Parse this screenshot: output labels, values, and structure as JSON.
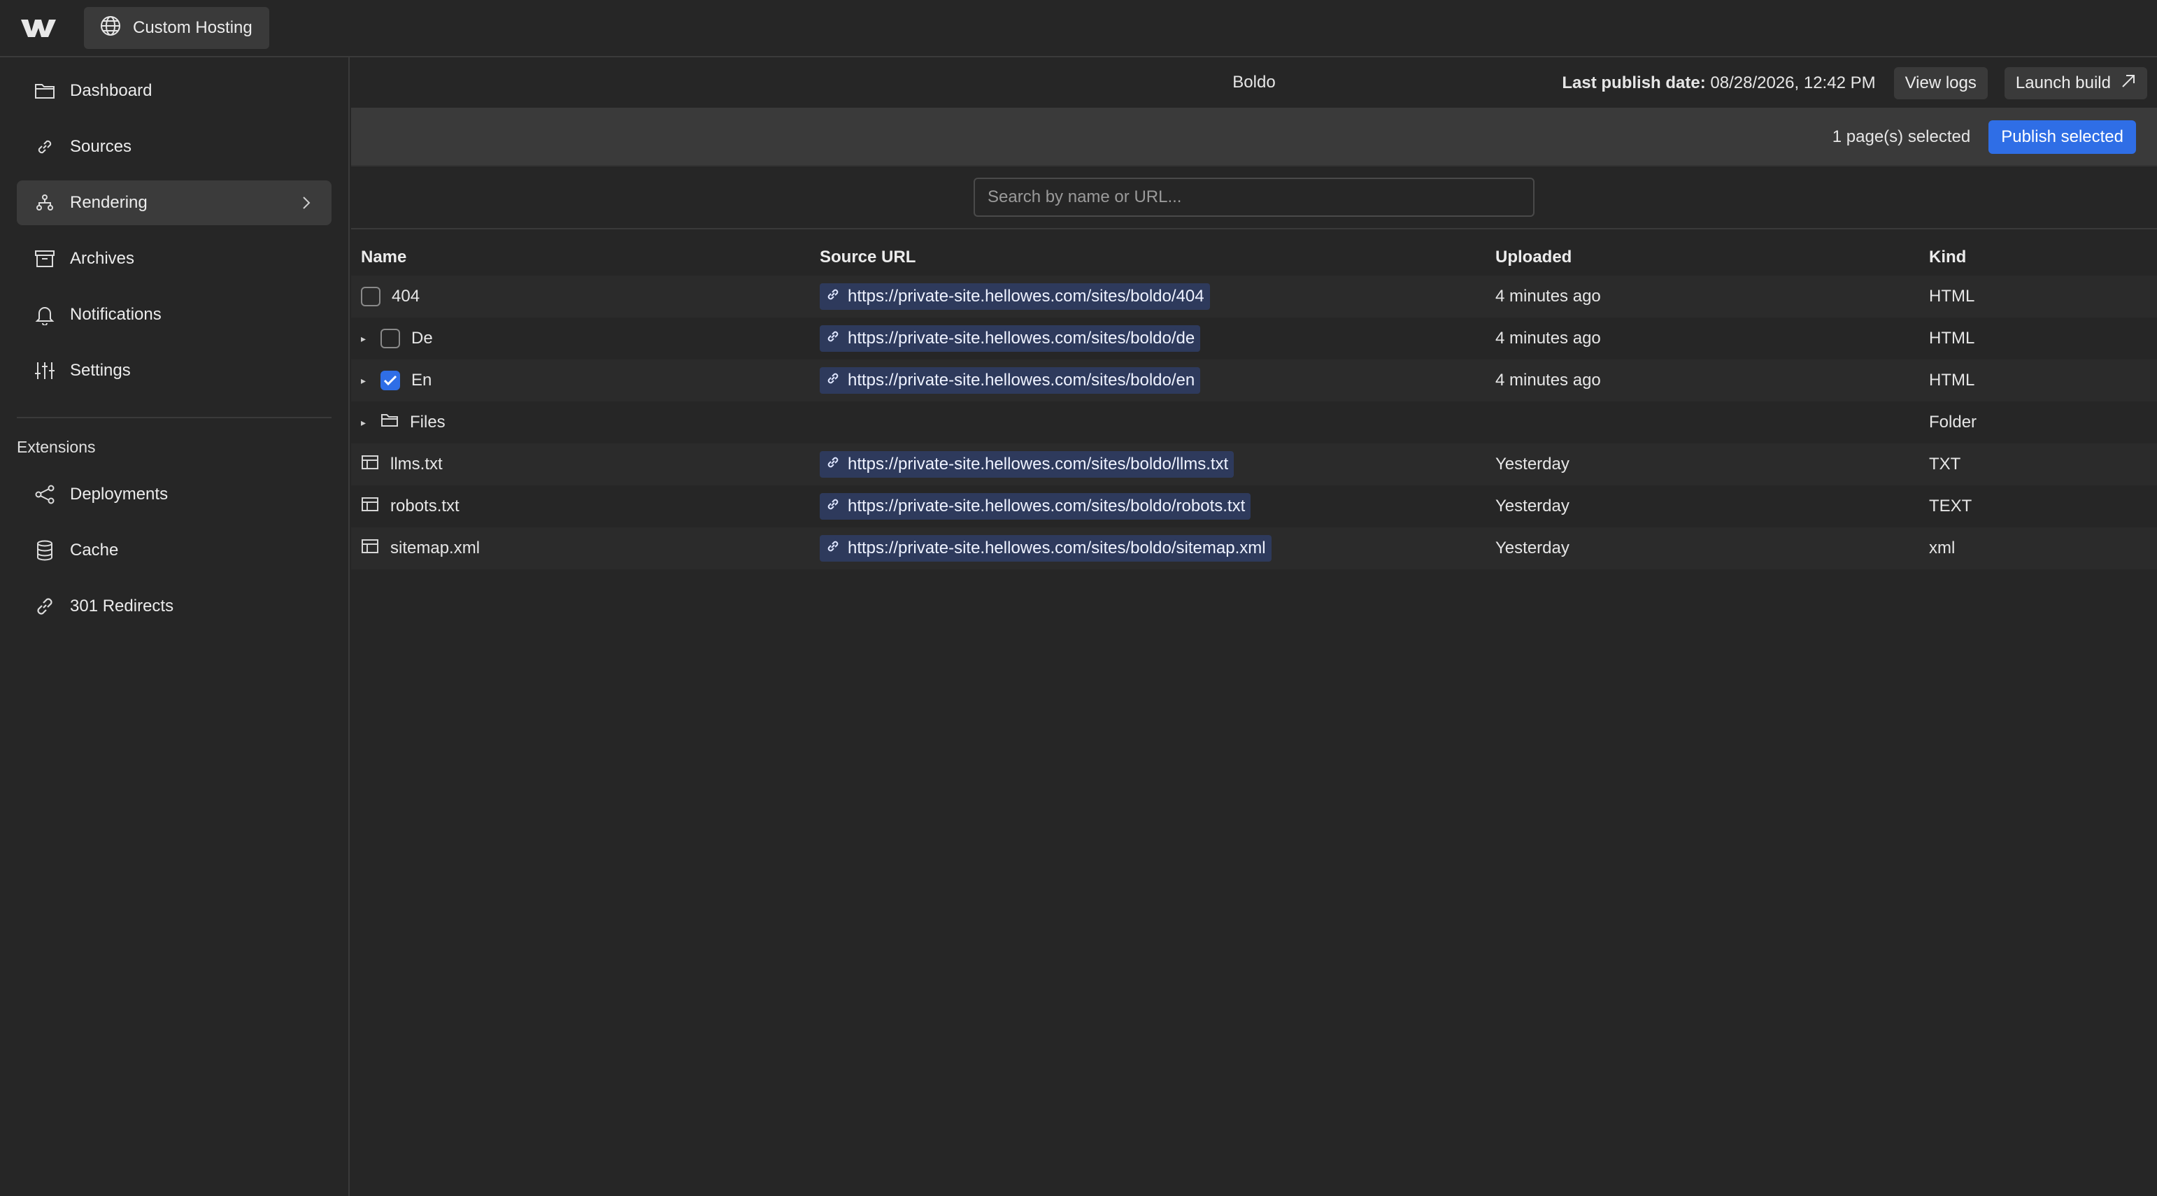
{
  "topbar": {
    "app_label": "Custom Hosting"
  },
  "sidebar": {
    "items": [
      {
        "label": "Dashboard",
        "icon": "folder-icon"
      },
      {
        "label": "Sources",
        "icon": "link-icon"
      },
      {
        "label": "Rendering",
        "icon": "sitemap-icon",
        "active": true
      },
      {
        "label": "Archives",
        "icon": "archive-icon"
      },
      {
        "label": "Notifications",
        "icon": "bell-icon"
      },
      {
        "label": "Settings",
        "icon": "sliders-icon"
      }
    ],
    "extensions_label": "Extensions",
    "extensions": [
      {
        "label": "Deployments",
        "icon": "share-icon"
      },
      {
        "label": "Cache",
        "icon": "database-icon"
      },
      {
        "label": "301 Redirects",
        "icon": "chain-icon"
      }
    ]
  },
  "header": {
    "site_name": "Boldo",
    "last_publish_label": "Last publish date:",
    "last_publish_value": "08/28/2026, 12:42 PM",
    "view_logs": "View logs",
    "launch_build": "Launch build"
  },
  "selection": {
    "text": "1 page(s) selected",
    "publish_selected": "Publish selected"
  },
  "search": {
    "placeholder": "Search by name or URL..."
  },
  "table": {
    "headers": {
      "name": "Name",
      "source": "Source URL",
      "uploaded": "Uploaded",
      "kind": "Kind"
    },
    "rows": [
      {
        "name": "404",
        "url": "https://private-site.hellowes.com/sites/boldo/404",
        "uploaded": "4 minutes ago",
        "kind": "HTML"
      },
      {
        "name": "De",
        "url": "https://private-site.hellowes.com/sites/boldo/de",
        "uploaded": "4 minutes ago",
        "kind": "HTML"
      },
      {
        "name": "En",
        "url": "https://private-site.hellowes.com/sites/boldo/en",
        "uploaded": "4 minutes ago",
        "kind": "HTML"
      },
      {
        "name": "Files",
        "url": "",
        "uploaded": "",
        "kind": "Folder"
      },
      {
        "name": "llms.txt",
        "url": "https://private-site.hellowes.com/sites/boldo/llms.txt",
        "uploaded": "Yesterday",
        "kind": "TXT"
      },
      {
        "name": "robots.txt",
        "url": "https://private-site.hellowes.com/sites/boldo/robots.txt",
        "uploaded": "Yesterday",
        "kind": "TEXT"
      },
      {
        "name": "sitemap.xml",
        "url": "https://private-site.hellowes.com/sites/boldo/sitemap.xml",
        "uploaded": "Yesterday",
        "kind": "xml"
      }
    ]
  }
}
